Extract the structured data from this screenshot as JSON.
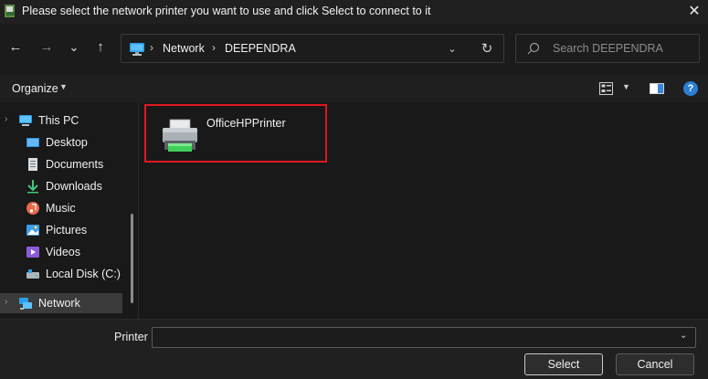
{
  "window": {
    "title": "Please select the network printer you want to use and click Select to connect to it",
    "close_glyph": "✕"
  },
  "nav": {
    "back_glyph": "←",
    "forward_glyph": "→",
    "recent_glyph": "⌄",
    "up_glyph": "↑",
    "breadcrumb": [
      "Network",
      "DEEPENDRA"
    ],
    "breadcrumb_sep": "›",
    "dropdown_glyph": "⌄",
    "refresh_glyph": "↻",
    "search_placeholder": "Search DEEPENDRA"
  },
  "toolbar": {
    "organize_label": "Organize",
    "caret_glyph": "▼",
    "help_glyph": "?"
  },
  "sidebar": {
    "this_pc": "This PC",
    "items": [
      {
        "label": "Desktop",
        "icon": "desktop-icon"
      },
      {
        "label": "Documents",
        "icon": "documents-icon"
      },
      {
        "label": "Downloads",
        "icon": "downloads-icon"
      },
      {
        "label": "Music",
        "icon": "music-icon"
      },
      {
        "label": "Pictures",
        "icon": "pictures-icon"
      },
      {
        "label": "Videos",
        "icon": "videos-icon"
      },
      {
        "label": "Local Disk (C:)",
        "icon": "local-disk-icon"
      }
    ],
    "network": "Network",
    "chevron_glyph": "›"
  },
  "content": {
    "items": [
      {
        "name": "OfficeHPPrinter",
        "icon": "printer-icon"
      }
    ],
    "highlight_color": "#e0181f"
  },
  "footer": {
    "printer_label": "Printer",
    "printer_value": "",
    "select_label": "Select",
    "cancel_label": "Cancel",
    "dropdown_glyph": "⌄"
  }
}
